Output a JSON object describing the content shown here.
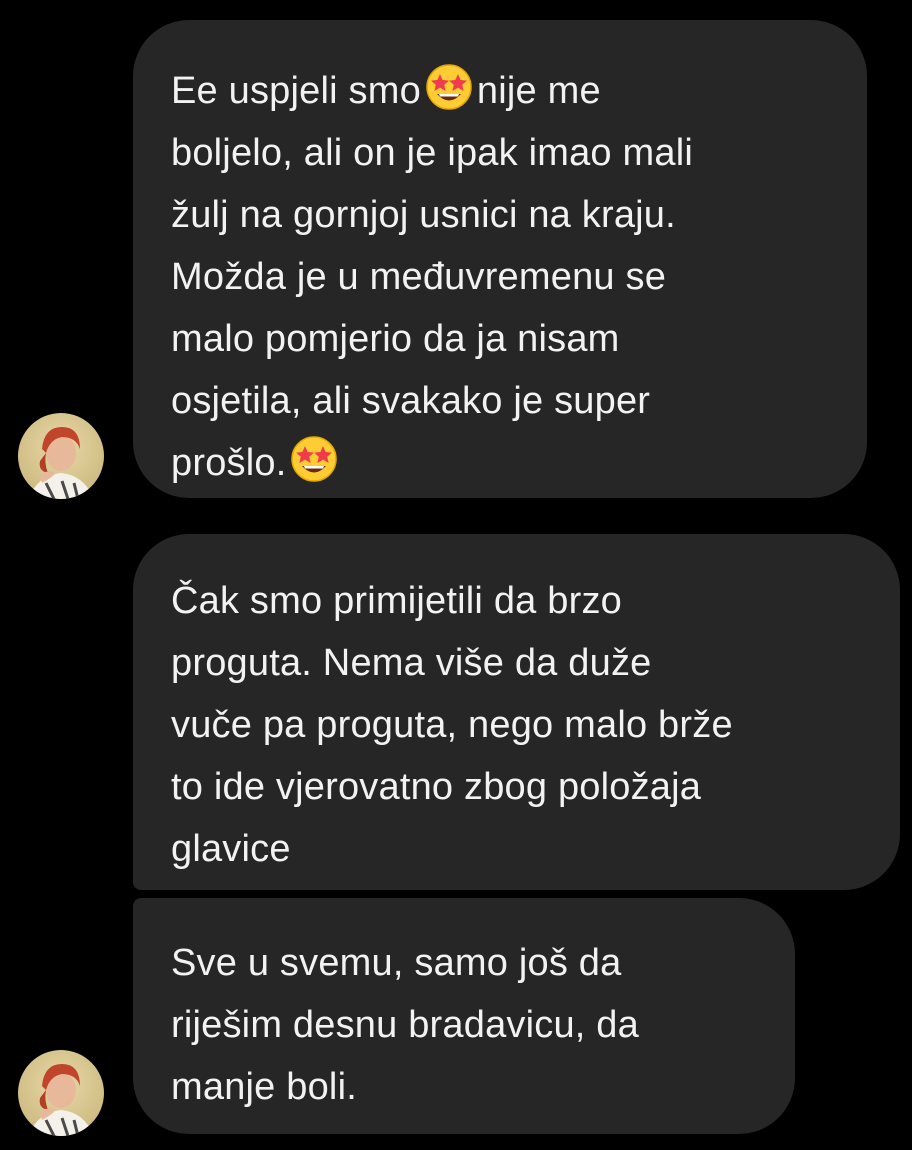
{
  "messages": [
    {
      "part1": "Ee uspjeli smo",
      "part2": "nije me\nboljelo, ali on je ipak imao mali\nžulj na gornjoj usnici na kraju.\nMožda je u međuvremenu se\nmalo pomjerio da ja nisam\nosjetila, ali svakako je super\nprošlo.",
      "emoji": "star-struck-emoji"
    },
    {
      "text": "Čak smo primijetili da brzo\nproguta. Nema više da duže\nvuče pa proguta, nego malo brže\nto ide vjerovatno zbog položaja\nglavice"
    },
    {
      "text": "Sve u svemu, samo još da\nriješim desnu bradavicu, da\nmanje boli."
    }
  ],
  "avatar": {
    "icon": "profile-photo-avatar"
  },
  "colors": {
    "background": "#000000",
    "bubble": "#262626",
    "text": "#f2f2f2"
  }
}
